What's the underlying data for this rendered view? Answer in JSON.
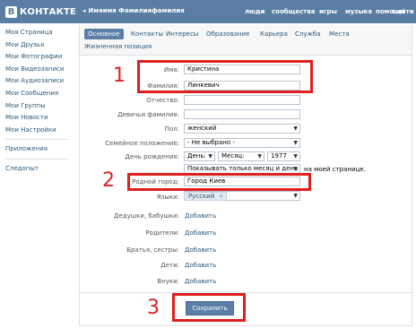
{
  "brand": {
    "logo_letter": "B",
    "logo_text": "КОНТАКТЕ"
  },
  "header": {
    "back_label": "Имяимя Фамилияфамилия",
    "nav": [
      "люди",
      "сообщества",
      "игры",
      "музыка",
      "помощь",
      "выйти"
    ]
  },
  "sidebar": {
    "items": [
      "Моя Страница",
      "Мои Друзья",
      "Мои Фотографии",
      "Мои Видеозаписи",
      "Мои Аудиозаписи",
      "Мои Сообщения",
      "Мои Группы",
      "Мои Новости",
      "Мои Настройки"
    ],
    "extra": [
      "Приложения",
      "Следопыт"
    ]
  },
  "tabs": {
    "row1": [
      "Основное",
      "Контакты",
      "Интересы",
      "Образование",
      "Карьера",
      "Служба",
      "Места"
    ],
    "row2": [
      "Жизненная позиция"
    ],
    "active": "Основное"
  },
  "form": {
    "first_name_label": "Имя:",
    "first_name_value": "Кристина",
    "last_name_label": "Фамилия:",
    "last_name_value": "Линкевич",
    "patronymic_label": "Отчество:",
    "patronymic_value": "",
    "maiden_label": "Девичья фамилия:",
    "maiden_value": "",
    "gender_label": "Пол:",
    "gender_value": "женский",
    "marital_label": "Семейное положение:",
    "marital_value": "- Не выбрано -",
    "birthday_label": "День рождения:",
    "bday_day": "День:",
    "bday_month": "Месяц:",
    "bday_year": "1977",
    "bday_visibility": "Показывать только месяц и день",
    "bday_visibility_suffix": "на моей странице.",
    "hometown_label": "Родной город:",
    "hometown_value": "Город Киев",
    "languages_label": "Языки:",
    "language_tag": "Русский",
    "grandparents_label": "Дедушки, бабушки:",
    "parents_label": "Родители:",
    "siblings_label": "Братья, сестры:",
    "children_label": "Дети:",
    "grandchildren_label": "Внуки:",
    "add_label": "Добавить",
    "save_label": "Сохранить"
  },
  "annotations": {
    "n1": "1",
    "n2": "2",
    "n3": "3",
    "color": "#e0201e"
  },
  "colors": {
    "header": "#597da3",
    "link": "#2b587a",
    "button": "#5b7fa6"
  }
}
